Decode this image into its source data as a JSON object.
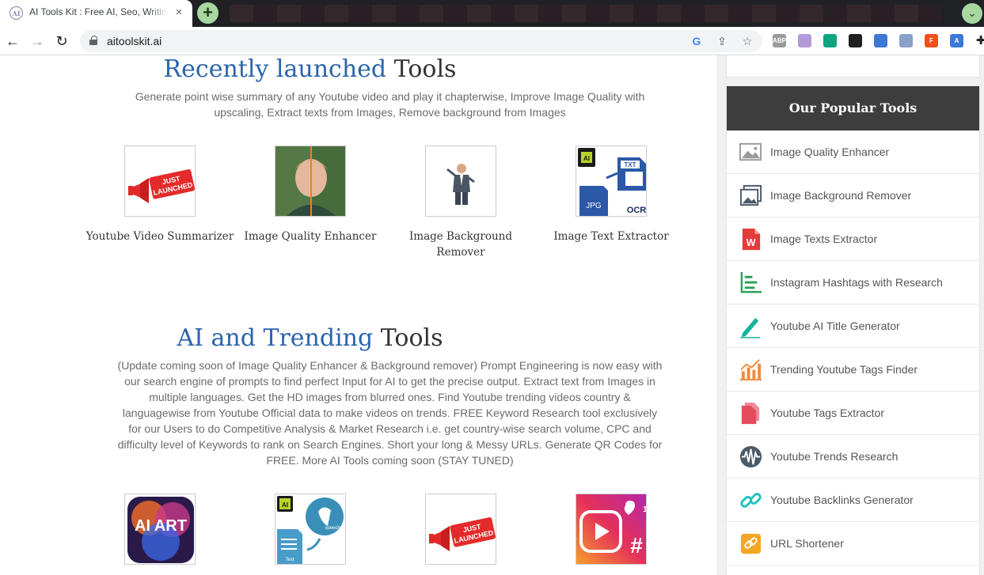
{
  "browser": {
    "tab_title": "AI Tools Kit : Free AI, Seo, Writing",
    "tab_favicon": "AI",
    "new_tab_symbol": "+",
    "close_symbol": "×",
    "url": "aitoolskit.ai",
    "extensions": [
      {
        "name": "abp-icon",
        "text": "ABP",
        "color": "#9a9a9a"
      },
      {
        "name": "extension-purple-icon",
        "text": "",
        "color": "#b49ad8"
      },
      {
        "name": "extension-green-icon",
        "text": "",
        "color": "#10a37f"
      },
      {
        "name": "extension-dark-icon",
        "text": "",
        "color": "#1f1f1f"
      },
      {
        "name": "extension-blue-icon",
        "text": "",
        "color": "#3b78d8"
      },
      {
        "name": "shield-extension-icon",
        "text": "",
        "color": "#8aa1c8"
      },
      {
        "name": "figma-icon",
        "text": "F",
        "color": "#f24e1e"
      },
      {
        "name": "translate-icon",
        "text": "A",
        "color": "#3b78d8"
      }
    ]
  },
  "recent": {
    "title_highlight": "Recently launched",
    "title_rest": " Tools",
    "description": "Generate point wise summary of any Youtube video and play it chapterwise, Improve Image Quality with upscaling, Extract texts from Images, Remove background from Images",
    "tools": [
      {
        "label": "Youtube Video Summarizer",
        "icon": "just-launched-icon"
      },
      {
        "label": "Image Quality Enhancer",
        "icon": "portrait-photo-icon"
      },
      {
        "label": "Image Background Remover",
        "icon": "businessman-icon"
      },
      {
        "label": "Image Text Extractor",
        "icon": "ocr-icon"
      }
    ]
  },
  "trending": {
    "title_highlight": "AI and Trending",
    "title_rest": " Tools",
    "description": "(Update coming soon of Image Quality Enhancer & Background remover) Prompt Engineering is now easy with our search engine of prompts to find perfect Input for AI to get the precise output. Extract text from Images in multiple languages. Get the HD images from blurred ones. Find Youtube trending videos country & languagewise from Youtube Official data to make videos on trends. FREE Keyword Research tool exclusively for our Users to do Competitive Analysis & Market Research i.e. get country-wise search volume, CPC and difficulty level of Keywords to rank on Search Engines. Short your long & Messy URLs. Generate QR Codes for FREE. More AI Tools coming soon (STAY TUNED)",
    "tools": [
      {
        "icon": "ai-art-icon",
        "text": "AI ART"
      },
      {
        "icon": "text-to-speech-icon",
        "text": "AI"
      },
      {
        "icon": "just-launched-icon",
        "text": "JUST LAUNCHED"
      },
      {
        "icon": "reels-hashtag-icon",
        "text": "1"
      }
    ]
  },
  "sidebar": {
    "heading": "Our Popular Tools",
    "items": [
      {
        "label": "Image Quality Enhancer",
        "icon": "image-icon",
        "color": "#9a9a9a"
      },
      {
        "label": "Image Background Remover",
        "icon": "gallery-icon",
        "color": "#4a5a6a"
      },
      {
        "label": "Image Texts Extractor",
        "icon": "word-doc-icon",
        "color": "#e23c3c"
      },
      {
        "label": "Instagram Hashtags with Research",
        "icon": "tree-chart-icon",
        "color": "#2e9e58"
      },
      {
        "label": "Youtube AI Title Generator",
        "icon": "pencil-icon",
        "color": "#18b49a"
      },
      {
        "label": "Trending Youtube Tags Finder",
        "icon": "bar-chart-icon",
        "color": "#f08a3c"
      },
      {
        "label": "Youtube Tags Extractor",
        "icon": "document-icon",
        "color": "#e34c5c"
      },
      {
        "label": "Youtube Trends Research",
        "icon": "waveform-icon",
        "color": "#4a5a6a"
      },
      {
        "label": "Youtube Backlinks Generator",
        "icon": "link-icon",
        "color": "#1fc2c2"
      },
      {
        "label": "URL Shortener",
        "icon": "short-link-icon",
        "color": "#f5a623"
      }
    ]
  },
  "labels": {
    "just": "JUST",
    "launched": "LAUNCHED",
    "ai": "AI",
    "txt": "TXT",
    "jpg": "JPG",
    "ocr": "OCR",
    "speech": "speech",
    "text": "Text"
  }
}
